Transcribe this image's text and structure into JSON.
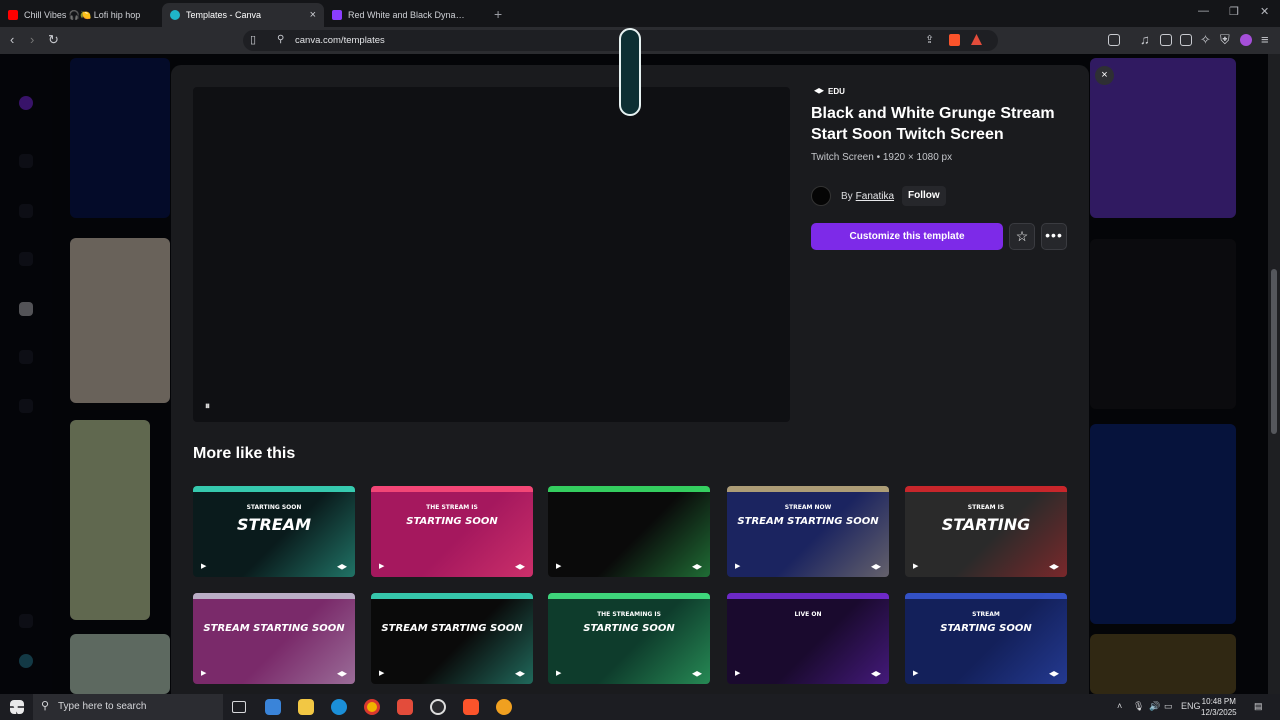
{
  "browser": {
    "tabs": [
      {
        "label": "Chill Vibes 🎧🍋 Lofi hip hop",
        "color": "#ff0000",
        "active": false
      },
      {
        "label": "Templates - Canva",
        "color": "#1fb6c9",
        "active": true
      },
      {
        "label": "Red White and Black Dynamic Live St",
        "color": "#8b3dff",
        "active": false
      }
    ],
    "new_tab": "+",
    "url": "canva.com/templates"
  },
  "modal": {
    "badge": "EDU",
    "title": "Black and White Grunge Stream Start Soon Twitch Screen",
    "subtitle": "Twitch Screen • 1920 × 1080 px",
    "author_prefix": "By",
    "author_name": "Fanatika",
    "follow_label": "Follow",
    "customize_label": "Customize this template",
    "pause_icon": "⏸",
    "close_icon": "×",
    "more_section_title": "More like this",
    "thumbnails": [
      {
        "text": "STREAM",
        "sub": "STARTING SOON",
        "bg": "#0a1b1c",
        "accent": "#3ee8c8"
      },
      {
        "text": "STARTING SOON",
        "sub": "THE STREAM IS",
        "bg": "#a5185e",
        "accent": "#ff4f7a"
      },
      {
        "text": "",
        "sub": "",
        "bg": "#0a0a0a",
        "accent": "#3cf06e"
      },
      {
        "text": "STREAM STARTING SOON",
        "sub": "STREAM NOW",
        "bg": "#1b2460",
        "accent": "#c6b27a"
      },
      {
        "text": "STARTING",
        "sub": "STREAM IS",
        "bg": "#2a2a2a",
        "accent": "#e3262c"
      },
      {
        "text": "STREAM STARTING SOON",
        "sub": "",
        "bg": "#7a2a6a",
        "accent": "#c6c6d6"
      },
      {
        "text": "STREAM STARTING SOON",
        "sub": "",
        "bg": "#0a0a0a",
        "accent": "#3ee8c8"
      },
      {
        "text": "STARTING SOON",
        "sub": "THE STREAMING IS",
        "bg": "#0e3c2c",
        "accent": "#47f08a"
      },
      {
        "text": "",
        "sub": "LIVE ON",
        "bg": "#1a0a2e",
        "accent": "#7b2fe0"
      },
      {
        "text": "STARTING SOON",
        "sub": "STREAM",
        "bg": "#13205a",
        "accent": "#3a5bd8"
      }
    ]
  },
  "taskbar": {
    "search_placeholder": "Type here to search",
    "language": "ENG",
    "time": "10:48 PM",
    "date": "12/3/2025"
  }
}
